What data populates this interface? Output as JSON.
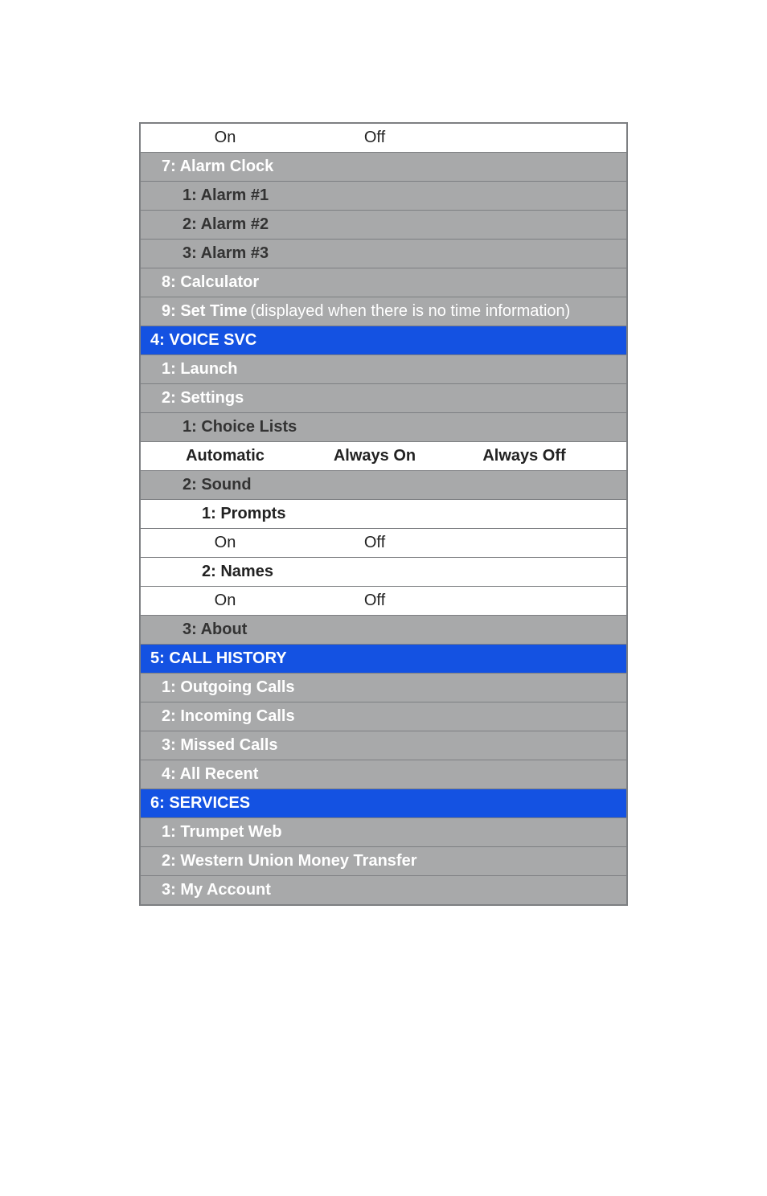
{
  "top_options": {
    "o1": "On",
    "o2": "Off",
    "o3": ""
  },
  "sec3": {
    "alarm_clock": "7: Alarm Clock",
    "alarm1": "1: Alarm #1",
    "alarm2": "2: Alarm #2",
    "alarm3": "3: Alarm #3",
    "calculator": "8: Calculator",
    "set_time_label": "9: Set Time",
    "set_time_note": " (displayed when there is no time information)"
  },
  "voice": {
    "header": "4: VOICE SVC",
    "launch": "1: Launch",
    "settings": "2: Settings",
    "choice_lists": "1: Choice Lists",
    "choice_opts": {
      "o1": "Automatic",
      "o2": "Always On",
      "o3": "Always Off"
    },
    "sound": "2: Sound",
    "prompts": "1: Prompts",
    "prompts_opts": {
      "o1": "On",
      "o2": "Off",
      "o3": ""
    },
    "names": "2: Names",
    "names_opts": {
      "o1": "On",
      "o2": "Off",
      "o3": ""
    },
    "about": "3: About"
  },
  "call_history": {
    "header": "5: CALL HISTORY",
    "outgoing": "1: Outgoing Calls",
    "incoming": "2: Incoming Calls",
    "missed": "3: Missed Calls",
    "all_recent": "4: All Recent"
  },
  "services": {
    "header": "6: SERVICES",
    "trumpet": "1: Trumpet Web",
    "western_union": "2: Western Union Money Transfer",
    "my_account": "3: My Account"
  }
}
